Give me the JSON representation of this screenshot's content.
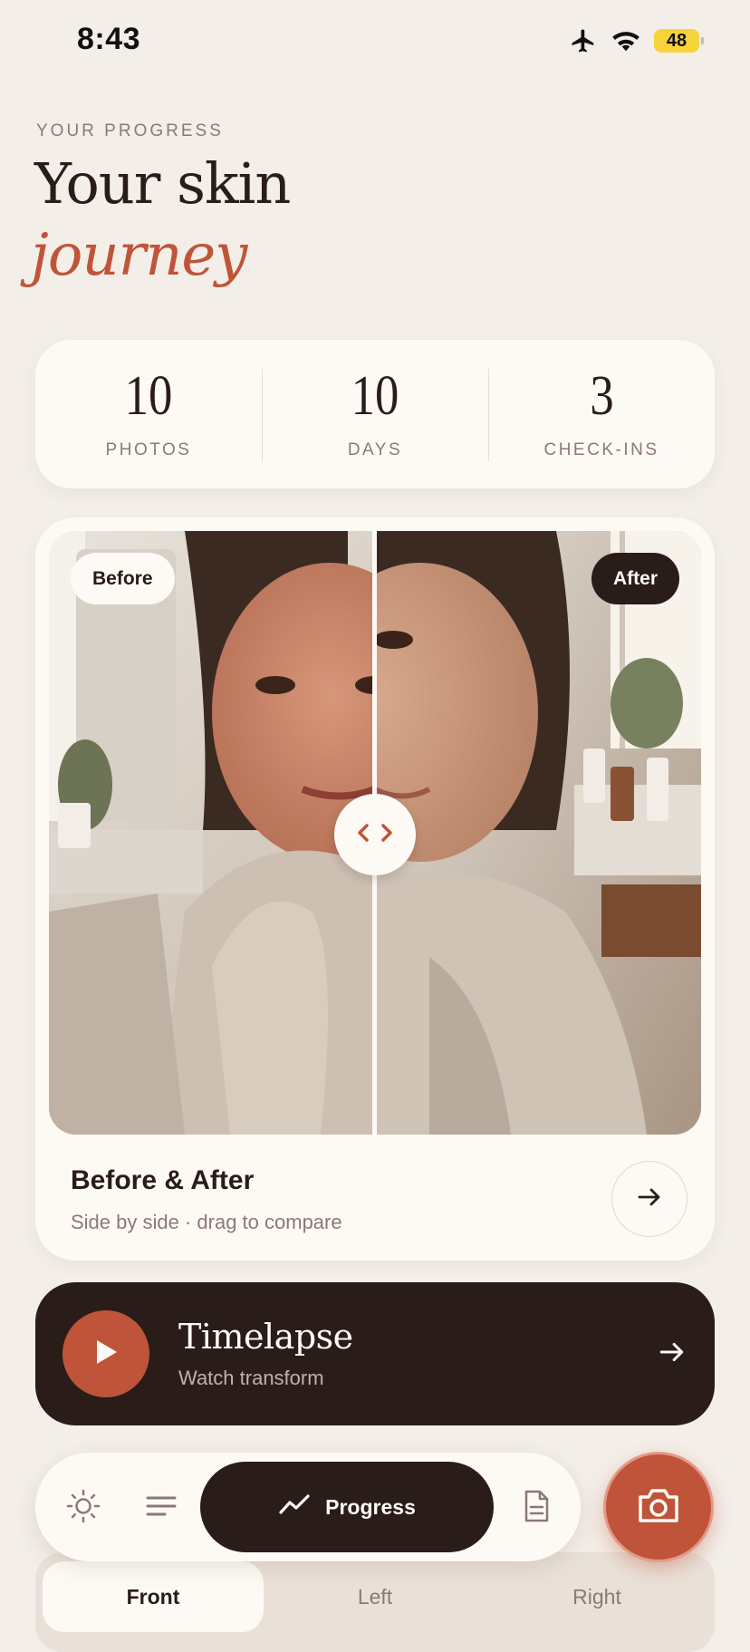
{
  "status_bar": {
    "time": "8:43",
    "battery": "48"
  },
  "header": {
    "eyebrow": "YOUR PROGRESS",
    "title_line1": "Your skin",
    "title_line2": "journey"
  },
  "stats": [
    {
      "value": "10",
      "label": "PHOTOS"
    },
    {
      "value": "10",
      "label": "DAYS"
    },
    {
      "value": "3",
      "label": "CHECK-INS"
    }
  ],
  "compare": {
    "before_label": "Before",
    "after_label": "After",
    "title": "Before & After",
    "subtitle": "Side by side · drag to compare"
  },
  "timelapse": {
    "title": "Timelapse",
    "subtitle": "Watch transform"
  },
  "views": [
    {
      "label": "Front",
      "active": true
    },
    {
      "label": "Left",
      "active": false
    },
    {
      "label": "Right",
      "active": false
    }
  ],
  "nav": {
    "progress_label": "Progress",
    "icons": [
      "sun-icon",
      "list-icon",
      "progress-chart-icon",
      "document-icon",
      "camera-icon"
    ]
  },
  "colors": {
    "background": "#F3EEE8",
    "card": "#FDFAF5",
    "dark": "#2A1C18",
    "accent": "#C0543A",
    "muted": "#8C7A70"
  }
}
